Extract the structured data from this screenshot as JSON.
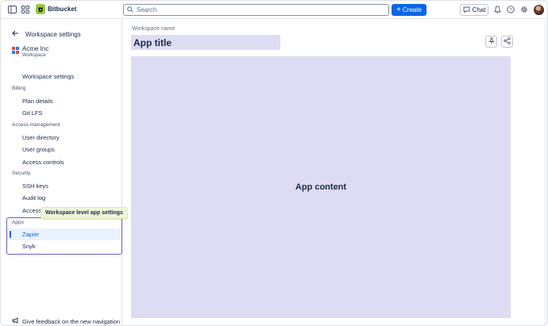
{
  "topbar": {
    "brand": "Bitbucket",
    "search_placeholder": "Search",
    "create_label": "Create",
    "chat_label": "Chat",
    "icons": [
      "sidebar-toggle-icon",
      "app-switcher-icon",
      "bitbucket-logo-icon",
      "search-icon",
      "plus-icon",
      "chat-icon",
      "bell-icon",
      "help-icon",
      "gear-icon"
    ]
  },
  "sidebar": {
    "back_label": "Workspace settings",
    "workspace_name": "Acme Inc",
    "workspace_sub": "Workspace",
    "items": {
      "workspace_settings": "Workspace settings",
      "billing": "Billing",
      "plan_details": "Plan details",
      "git_lfs": "Git LFS",
      "access_management": "Access management",
      "user_directory": "User directory",
      "user_groups": "User groups",
      "access_controls": "Access controls",
      "security": "Security",
      "ssh_keys": "SSH keys",
      "audit_log": "Audit log",
      "access_partial": "Access",
      "apps": "Apps",
      "zapier": "Zapier",
      "snyk": "Snyk"
    },
    "tooltip": "Workspace level app settings",
    "feedback": "Give feedback on the new navigation"
  },
  "main": {
    "workspace_label": "Workspace name",
    "app_title": "App title",
    "content_label": "App content"
  },
  "colors": {
    "accent": "#0c66e4",
    "placeholder_fill": "#dedcf2",
    "apps_outline": "#6e5dc6",
    "tooltip_bg": "#f0f5d8",
    "brand_logo": "#94c748"
  }
}
